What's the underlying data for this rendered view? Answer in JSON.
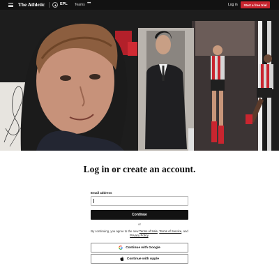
{
  "header": {
    "brand": "The Athletic",
    "league": "EPL",
    "teams_label": "Teams",
    "more_label": "•••",
    "login_label": "Log in",
    "trial_label": "Start a free trial"
  },
  "colors": {
    "topbar": "#121212",
    "trial_accent": "#c9252f",
    "primary_button": "#121212"
  },
  "icons": {
    "menu": "hamburger-icon",
    "league": "premier-league-logo-icon",
    "more": "ellipsis-icon",
    "google": "google-icon",
    "apple": "apple-icon"
  },
  "auth": {
    "heading": "Log in or create an account.",
    "email_label": "Email address",
    "email_value": "",
    "continue_label": "Continue",
    "or_label": "or",
    "terms_prefix": "By continuing, you agree to the new ",
    "terms_sale": "Terms of Sale",
    "terms_sep": ", ",
    "terms_service": "Terms of Service",
    "terms_and": ", and ",
    "terms_privacy": "Privacy Policy",
    "terms_end": ".",
    "google_label": "Continue with Google",
    "apple_label": "Continue with Apple"
  }
}
